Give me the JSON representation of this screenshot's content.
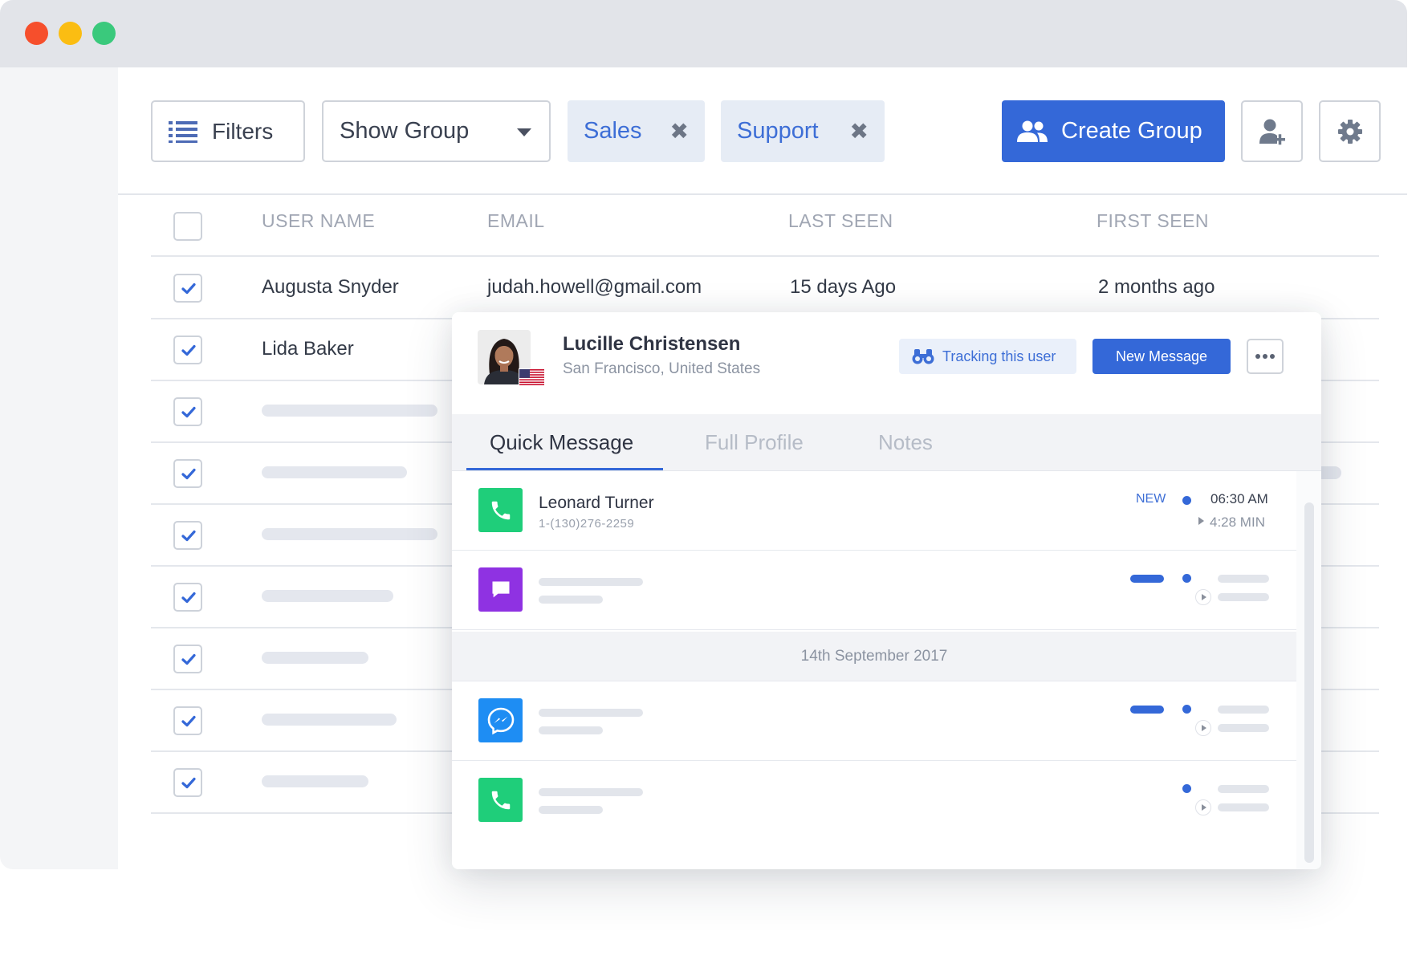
{
  "toolbar": {
    "filters_label": "Filters",
    "group_select_value": "Show Group",
    "chips": [
      "Sales",
      "Support"
    ],
    "chip_remove_symbol": "✖",
    "create_group_label": "Create Group"
  },
  "table": {
    "columns": [
      "USER NAME",
      "EMAIL",
      "LAST SEEN",
      "FIRST SEEN"
    ],
    "rows": [
      {
        "name": "Augusta Snyder",
        "email": "judah.howell@gmail.com",
        "last_seen": "15 days Ago",
        "first_seen": "2 months ago"
      },
      {
        "name": "Lida Baker"
      }
    ]
  },
  "profile": {
    "name": "Lucille Christensen",
    "location": "San Francisco, United States",
    "tracking_label": "Tracking this user",
    "new_message_label": "New Message",
    "tabs": [
      "Quick Message",
      "Full Profile",
      "Notes"
    ],
    "messages": [
      {
        "channel": "phone-icon",
        "name": "Leonard Turner",
        "phone": "1-(130)276-2259",
        "tag": "NEW",
        "time": "06:30 AM",
        "duration": "4:28 MIN"
      }
    ],
    "date_separator": "14th September 2017"
  },
  "colors": {
    "accent": "#3468d8",
    "phone": "#1fce7a",
    "chat": "#8f32e2",
    "messenger": "#1e8df3"
  }
}
